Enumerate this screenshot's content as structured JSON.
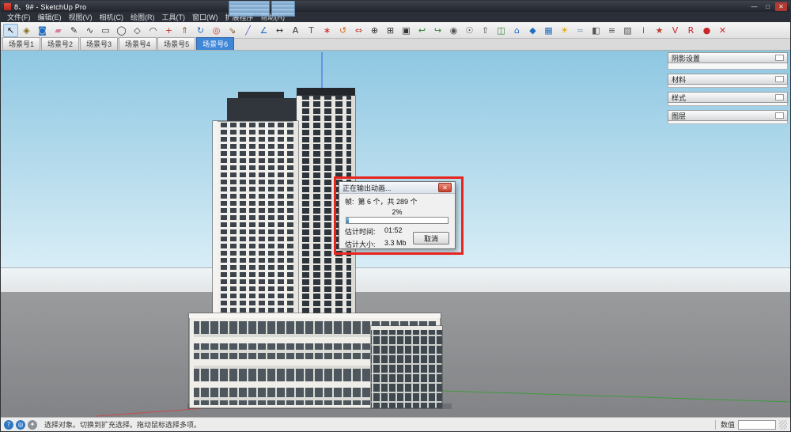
{
  "window": {
    "title": "8、9# - SketchUp Pro",
    "minimize": "—",
    "maximize": "□",
    "close": "✕"
  },
  "menu": {
    "items": [
      "文件(F)",
      "编辑(E)",
      "视图(V)",
      "相机(C)",
      "绘图(R)",
      "工具(T)",
      "窗口(W)",
      "扩展程序",
      "帮助(H)"
    ]
  },
  "toolbar": {
    "icons": [
      {
        "name": "select-icon",
        "glyph": "↖",
        "color": "#111111",
        "active": true
      },
      {
        "name": "make-component-icon",
        "glyph": "◈",
        "color": "#8a6d1a"
      },
      {
        "name": "paint-bucket-icon",
        "glyph": "◙",
        "color": "#1f6dbf"
      },
      {
        "name": "eraser-icon",
        "glyph": "▰",
        "color": "#d87fa0"
      },
      {
        "name": "line-icon",
        "glyph": "✎",
        "color": "#333333"
      },
      {
        "name": "freehand-icon",
        "glyph": "∿",
        "color": "#333333"
      },
      {
        "name": "rectangle-icon",
        "glyph": "▭",
        "color": "#333333"
      },
      {
        "name": "circle-icon",
        "glyph": "◯",
        "color": "#333333"
      },
      {
        "name": "polygon-icon",
        "glyph": "◇",
        "color": "#333333"
      },
      {
        "name": "arc-icon",
        "glyph": "◠",
        "color": "#333333"
      },
      {
        "name": "move-icon",
        "glyph": "+",
        "color": "#c0392b"
      },
      {
        "name": "push-pull-icon",
        "glyph": "⇑",
        "color": "#8b5a2b"
      },
      {
        "name": "rotate-icon",
        "glyph": "↻",
        "color": "#1f6dbf"
      },
      {
        "name": "offset-icon",
        "glyph": "◎",
        "color": "#c0392b"
      },
      {
        "name": "scale-icon",
        "glyph": "⇘",
        "color": "#8b5a2b"
      },
      {
        "name": "tape-measure-icon",
        "glyph": "╱",
        "color": "#6a5acd"
      },
      {
        "name": "protractor-icon",
        "glyph": "∠",
        "color": "#1f6dbf"
      },
      {
        "name": "dimension-icon",
        "glyph": "↔",
        "color": "#333333"
      },
      {
        "name": "text-icon",
        "glyph": "A",
        "color": "#333333"
      },
      {
        "name": "3d-text-icon",
        "glyph": "T",
        "color": "#555555"
      },
      {
        "name": "axes-icon",
        "glyph": "∗",
        "color": "#cc2222"
      },
      {
        "name": "orbit-icon",
        "glyph": "↺",
        "color": "#d2691e"
      },
      {
        "name": "pan-icon",
        "glyph": "⇔",
        "color": "#c0392b"
      },
      {
        "name": "zoom-icon",
        "glyph": "⊕",
        "color": "#333333"
      },
      {
        "name": "zoom-window-icon",
        "glyph": "⊞",
        "color": "#333333"
      },
      {
        "name": "zoom-extents-icon",
        "glyph": "▣",
        "color": "#333333"
      },
      {
        "name": "previous-view-icon",
        "glyph": "↩",
        "color": "#2e7d32"
      },
      {
        "name": "next-view-icon",
        "glyph": "↪",
        "color": "#2e7d32"
      },
      {
        "name": "position-camera-icon",
        "glyph": "◉",
        "color": "#555555"
      },
      {
        "name": "look-around-icon",
        "glyph": "☉",
        "color": "#555555"
      },
      {
        "name": "walk-icon",
        "glyph": "⇧",
        "color": "#555555"
      },
      {
        "name": "section-plane-icon",
        "glyph": "◫",
        "color": "#2e7d32"
      },
      {
        "name": "front-view-icon",
        "glyph": "⌂",
        "color": "#1f6dbf"
      },
      {
        "name": "iso-view-icon",
        "glyph": "◆",
        "color": "#1f6dbf"
      },
      {
        "name": "top-view-icon",
        "glyph": "▦",
        "color": "#1f6dbf"
      },
      {
        "name": "shadows-icon",
        "glyph": "☀",
        "color": "#e0a000"
      },
      {
        "name": "fog-icon",
        "glyph": "≈",
        "color": "#7fa8b8"
      },
      {
        "name": "styles-icon",
        "glyph": "◧",
        "color": "#555555"
      },
      {
        "name": "layers-icon",
        "glyph": "≡",
        "color": "#555555"
      },
      {
        "name": "materials-icon",
        "glyph": "▨",
        "color": "#555555"
      },
      {
        "name": "model-info-icon",
        "glyph": "i",
        "color": "#1f6dbf"
      },
      {
        "name": "extension-warehouse-icon",
        "glyph": "★",
        "color": "#c0392b"
      },
      {
        "name": "vray-frame-buffer-icon",
        "glyph": "V",
        "color": "#c62828"
      },
      {
        "name": "vray-render-icon",
        "glyph": "R",
        "color": "#c62828"
      },
      {
        "name": "vray-options-icon",
        "glyph": "●",
        "color": "#c62828"
      },
      {
        "name": "close-red-icon",
        "glyph": "✕",
        "color": "#c62828"
      }
    ]
  },
  "scene_tabs": {
    "items": [
      {
        "label": "场景号1",
        "active": false
      },
      {
        "label": "场景号2",
        "active": false
      },
      {
        "label": "场景号3",
        "active": false
      },
      {
        "label": "场景号4",
        "active": false
      },
      {
        "label": "场景号5",
        "active": false
      },
      {
        "label": "场景号6",
        "active": true
      }
    ]
  },
  "panels": {
    "items": [
      {
        "name": "panel-shadow-settings",
        "title": "阴影设置",
        "body_h": 8
      },
      {
        "name": "panel-materials",
        "title": "材料",
        "body_h": 4
      },
      {
        "name": "panel-styles",
        "title": "样式",
        "body_h": 4
      },
      {
        "name": "panel-layers",
        "title": "图层",
        "body_h": 4
      }
    ]
  },
  "dialog": {
    "title": "正在输出动画...",
    "close_glyph": "✕",
    "frame_label": "帧:",
    "frame_value": "第 6 个，共 289 个",
    "progress_text": "2%",
    "progress_value": 2,
    "est_time_label": "估计时间:",
    "est_time_value": "01:52",
    "est_size_label": "估计大小:",
    "est_size_value": "3.3 Mb",
    "cancel_label": "取消"
  },
  "statusbar": {
    "icons": [
      {
        "name": "help-icon",
        "glyph": "?",
        "bg": "#2f77c0"
      },
      {
        "name": "geolocation-icon",
        "glyph": "◎",
        "bg": "#2f77c0"
      },
      {
        "name": "credits-icon",
        "glyph": "✦",
        "bg": "#8a8f98"
      }
    ],
    "hint": "选择对象。切换到扩充选择。拖动鼠标选择多项。",
    "measure_label": "数值",
    "measure_value": ""
  },
  "colors": {
    "accent_blue": "#3e86d8",
    "annotation_red": "#e8241f",
    "sky": "#8ec7e2",
    "ground": "#8e8f91"
  }
}
